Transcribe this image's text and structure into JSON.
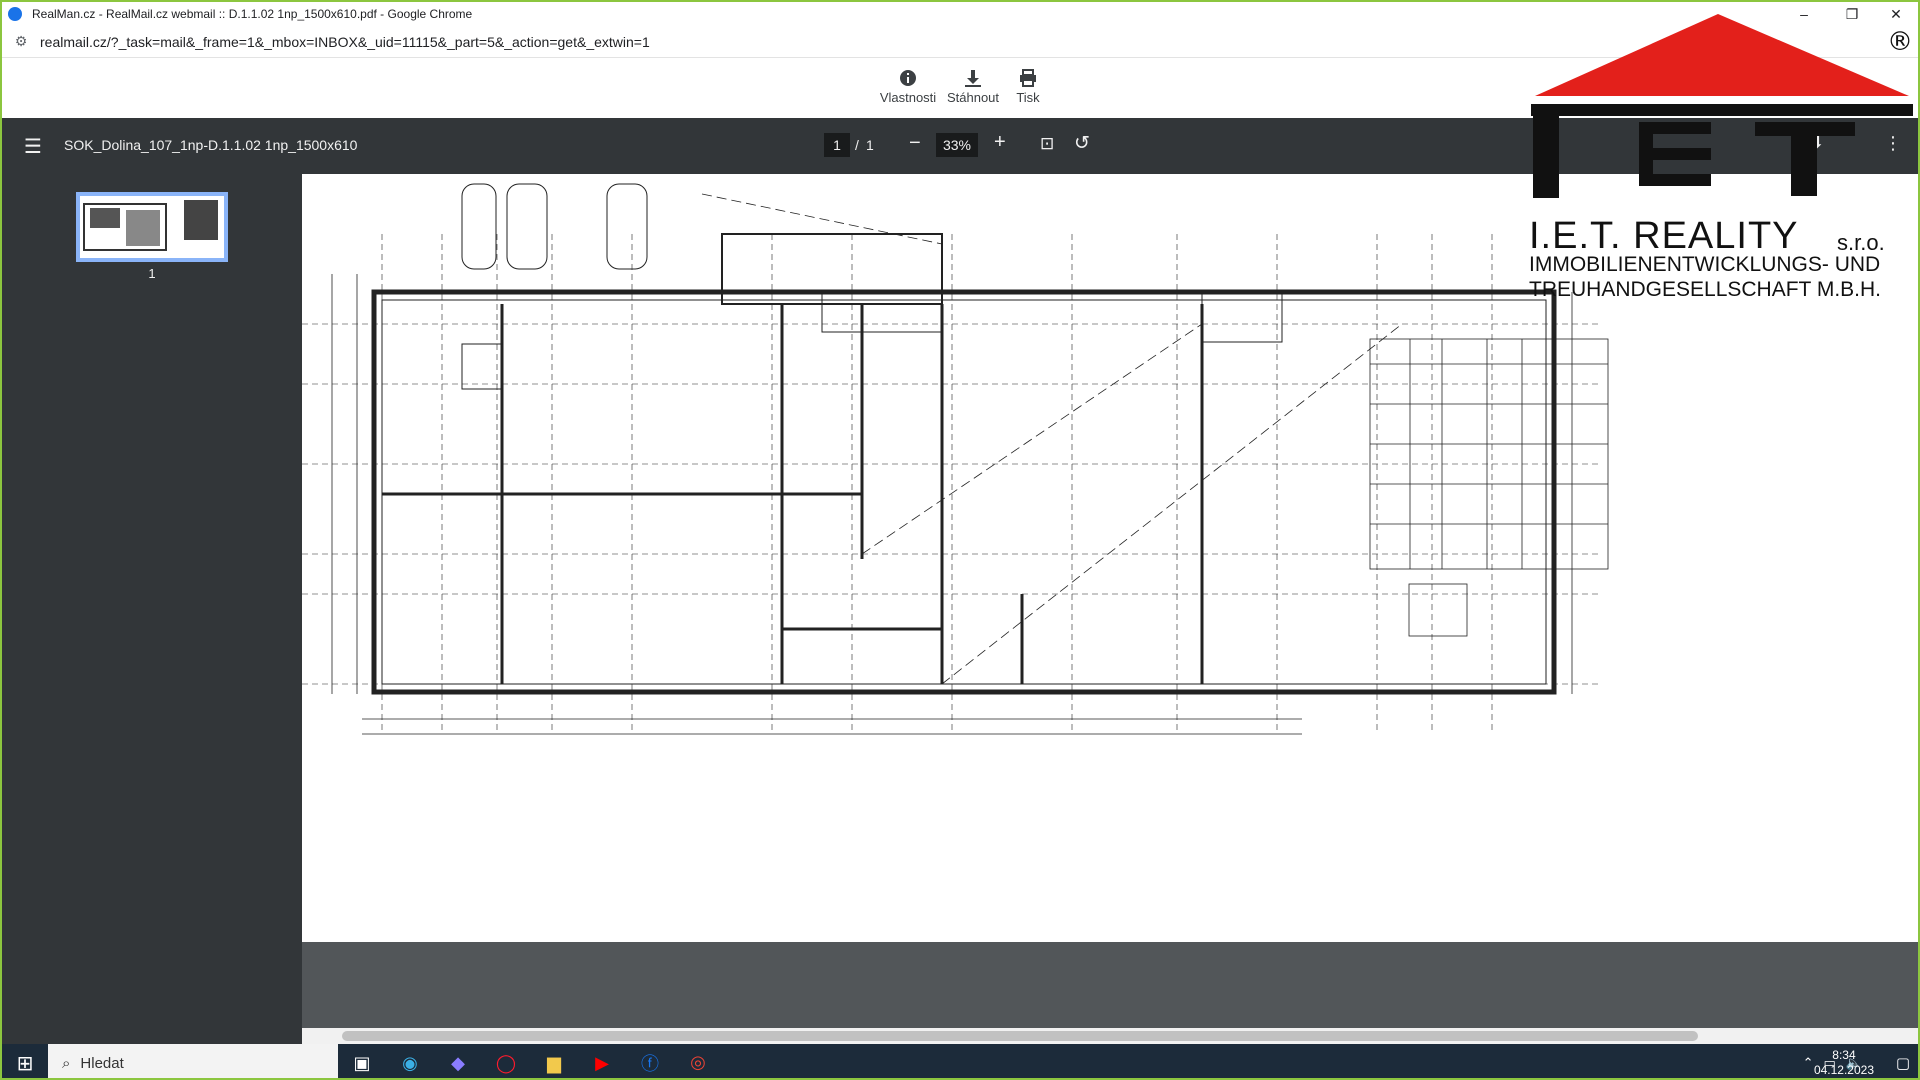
{
  "window": {
    "title": "RealMan.cz - RealMail.cz webmail :: D.1.1.02 1np_1500x610.pdf - Google Chrome",
    "minimize": "–",
    "maximize": "❐",
    "close": "✕"
  },
  "address": {
    "url": "realmail.cz/?_task=mail&_frame=1&_mbox=INBOX&_uid=11115&_part=5&_action=get&_extwin=1"
  },
  "mail_toolbar": {
    "properties_label": "Vlastnosti",
    "download_label": "Stáhnout",
    "print_label": "Tisk"
  },
  "logo": {
    "brand": "I.E.T. REALITY",
    "suffix": "s.r.o.",
    "line2": "IMMOBILIENENTWICKLUNGS- UND",
    "line3": "TREUHANDGESELLSCHAFT M.B.H.",
    "registered": "®",
    "colors": {
      "roof": "#e3201b",
      "text": "#111111"
    }
  },
  "pdf_viewer": {
    "file_name": "SOK_Dolina_107_1np-D.1.1.02 1np_1500x610",
    "current_page": "1",
    "separator": "/",
    "total_pages": "1",
    "zoom": "33%",
    "thumbnail_page_label": "1"
  },
  "taskbar": {
    "search_placeholder": "Hledat",
    "time": "8:34",
    "date": "04.12.2023",
    "apps": [
      "task-view",
      "edge",
      "copilot",
      "opera",
      "file-explorer",
      "youtube",
      "facebook",
      "chrome"
    ]
  }
}
